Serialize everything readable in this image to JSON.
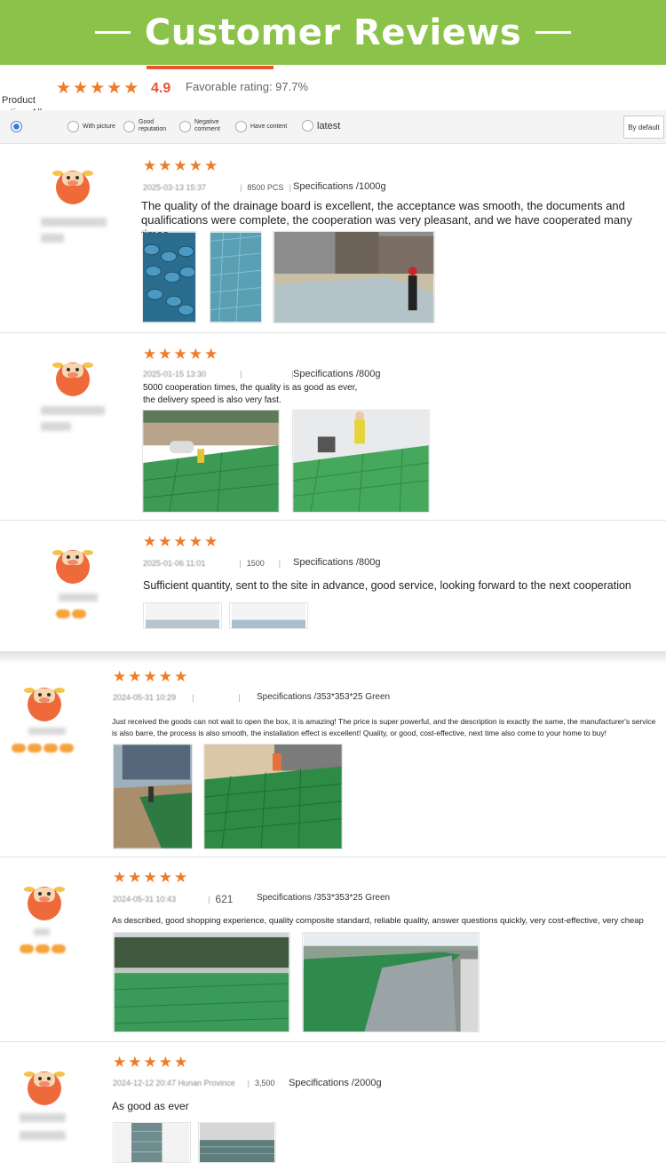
{
  "banner": {
    "title": "Customer Reviews"
  },
  "summary": {
    "score": "4.9",
    "favorable": "Favorable rating: 97.7%",
    "product_rating": "Product rating: All"
  },
  "filters": {
    "with_picture": "With picture",
    "good_reputation": "Good reputation",
    "negative_comment": "Negative comment",
    "have_content": "Have content",
    "latest": "latest",
    "sort": "By default"
  },
  "reviews": [
    {
      "date": "2025-03-13 15:37",
      "qty": "8500 PCS",
      "spec": "Specifications /1000g",
      "comment": "The quality of the drainage board is excellent, the acceptance was smooth, the documents and qualifications were complete, the cooperation was very pleasant, and we have cooperated many times."
    },
    {
      "date": "2025-01-15 13:30",
      "qty": "",
      "spec": "Specifications /800g",
      "comment_line1": "5000 cooperation times, the quality is as good as ever,",
      "comment_line2": "the delivery speed is also very fast."
    },
    {
      "date": "2025-01-06 11:01",
      "qty": "1500",
      "spec": "Specifications /800g",
      "comment": "Sufficient quantity, sent to the site in advance, good service, looking forward to the next cooperation"
    },
    {
      "date": "2024-05-31 10:29",
      "qty": "",
      "spec": "Specifications /353*353*25 Green",
      "comment": "Just received the goods can not wait to open the box, it is amazing! The price is super powerful, and the description is exactly the same, the manufacturer's service is also barre, the process is also smooth, the installation effect is excellent! Quality, or good, cost-effective, next time also come to your home to buy!"
    },
    {
      "date": "2024-05-31 10:43",
      "qty": "621",
      "spec": "Specifications /353*353*25 Green",
      "comment": "As described, good shopping experience, quality composite standard, reliable quality, answer questions quickly, very cost-effective, very cheap"
    },
    {
      "date": "2024-12-12 20:47 Hunan Province",
      "qty": "3,500",
      "spec": "Specifications /2000g",
      "comment": "As good as ever"
    }
  ],
  "colors": {
    "banner": "#8bc34a",
    "star": "#f07b2a",
    "score": "#e8542e",
    "avatar": "#ef6a3a"
  }
}
